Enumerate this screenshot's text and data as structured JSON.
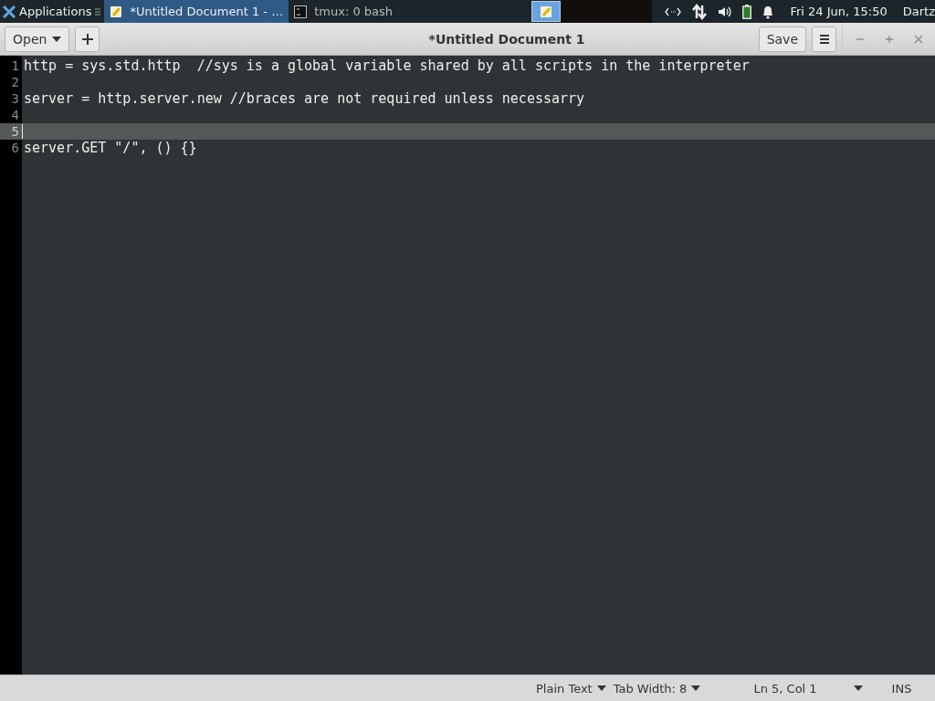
{
  "panel": {
    "apps_menu": "Applications",
    "tasks": [
      {
        "label": "*Untitled Document 1 - …",
        "kind": "editor",
        "selected": true
      },
      {
        "label": "tmux: 0 bash",
        "kind": "terminal",
        "selected": false
      }
    ],
    "clock": "Fri 24 Jun, 15:50",
    "user": "Dartz"
  },
  "header": {
    "open_button": "Open",
    "title": "*Untitled Document 1",
    "save_button": "Save"
  },
  "editor": {
    "lines": [
      {
        "number": "1",
        "text": "http = sys.std.http  //sys is a global variable shared by all scripts in the interpreter",
        "current": false
      },
      {
        "number": "2",
        "current": false
      },
      {
        "number": "3",
        "text": "server = http.server.new //braces are not required unless necessarry",
        "current": false
      },
      {
        "number": "4",
        "current": false
      },
      {
        "number": "5",
        "current": true
      },
      {
        "number": "6",
        "text": "server.GET \"/\", () {}",
        "current": false
      }
    ]
  },
  "status_bar": {
    "language": "Plain Text",
    "tab_width": "Tab Width: 8",
    "position": "Ln 5, Col 1",
    "mode": "INS"
  }
}
